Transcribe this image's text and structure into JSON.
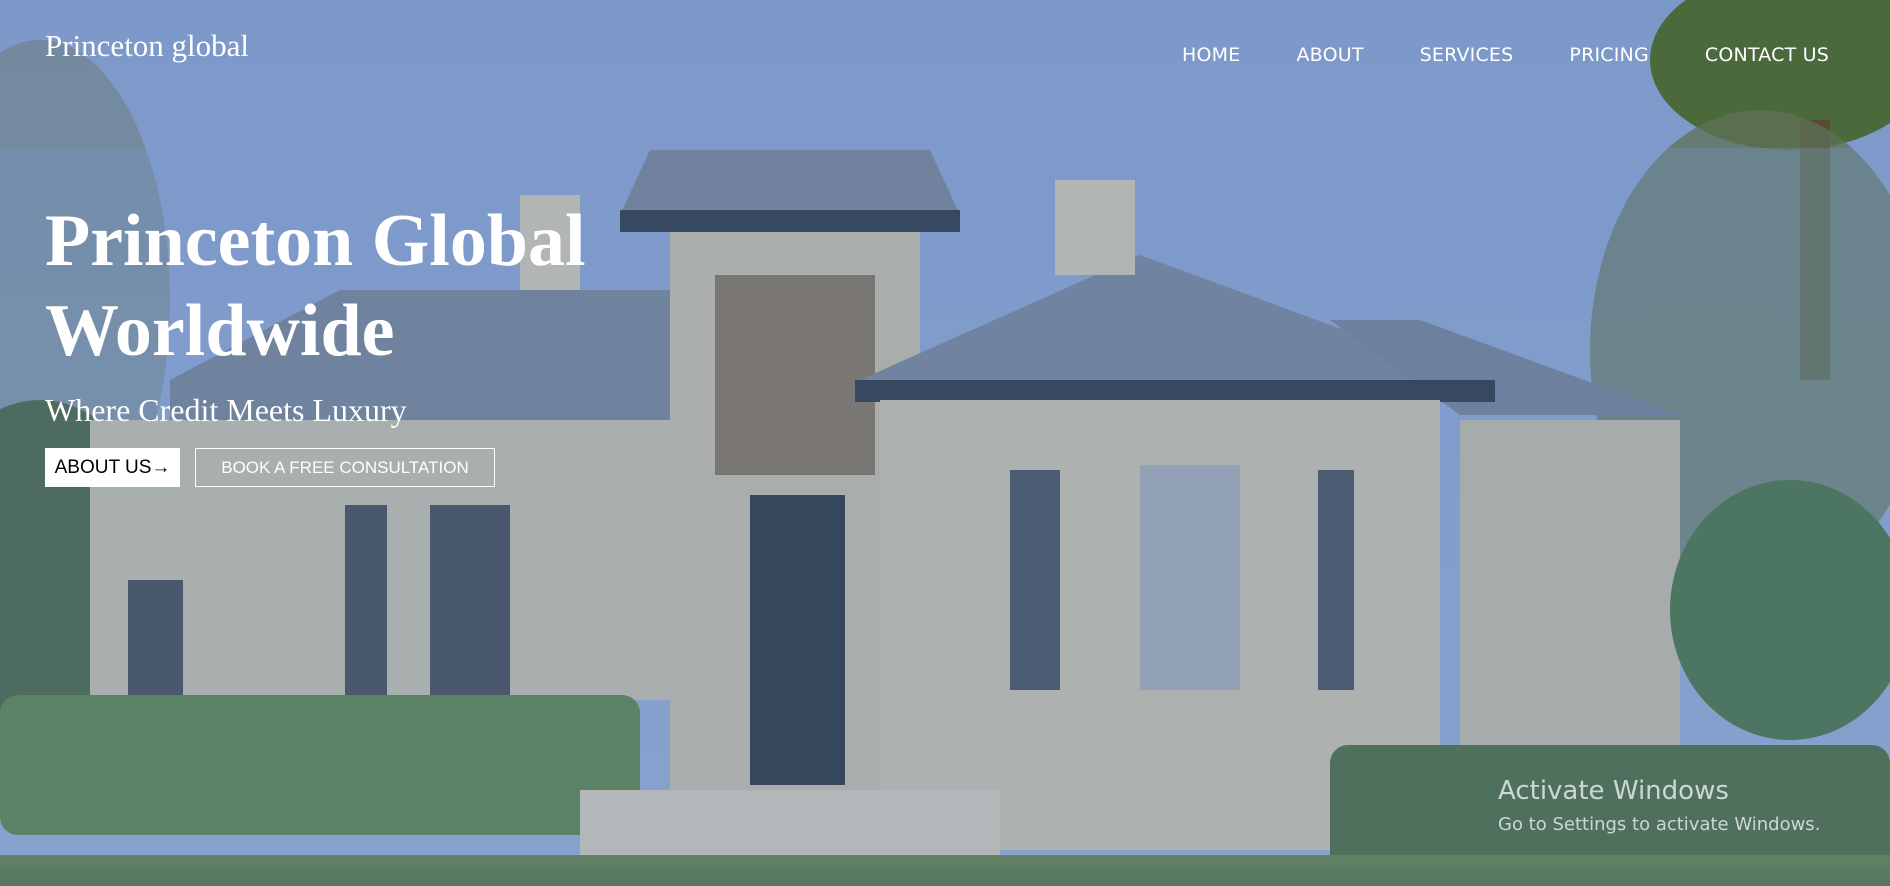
{
  "brand": {
    "name": "Princeton global"
  },
  "nav": {
    "items": [
      {
        "label": "HOME"
      },
      {
        "label": "ABOUT"
      },
      {
        "label": "SERVICES"
      },
      {
        "label": "PRICING"
      },
      {
        "label": "CONTACT US"
      }
    ]
  },
  "hero": {
    "title": "Princeton Global Worldwide",
    "subtitle": "Where Credit Meets Luxury",
    "primary_button": "ABOUT US→",
    "secondary_button": "BOOK A FREE CONSULTATION"
  },
  "os_watermark": {
    "title": "Activate Windows",
    "message": "Go to Settings to activate Windows."
  },
  "colors": {
    "sky": "#7f9bc7",
    "overlay": "#7896cd",
    "text": "#ffffff"
  }
}
